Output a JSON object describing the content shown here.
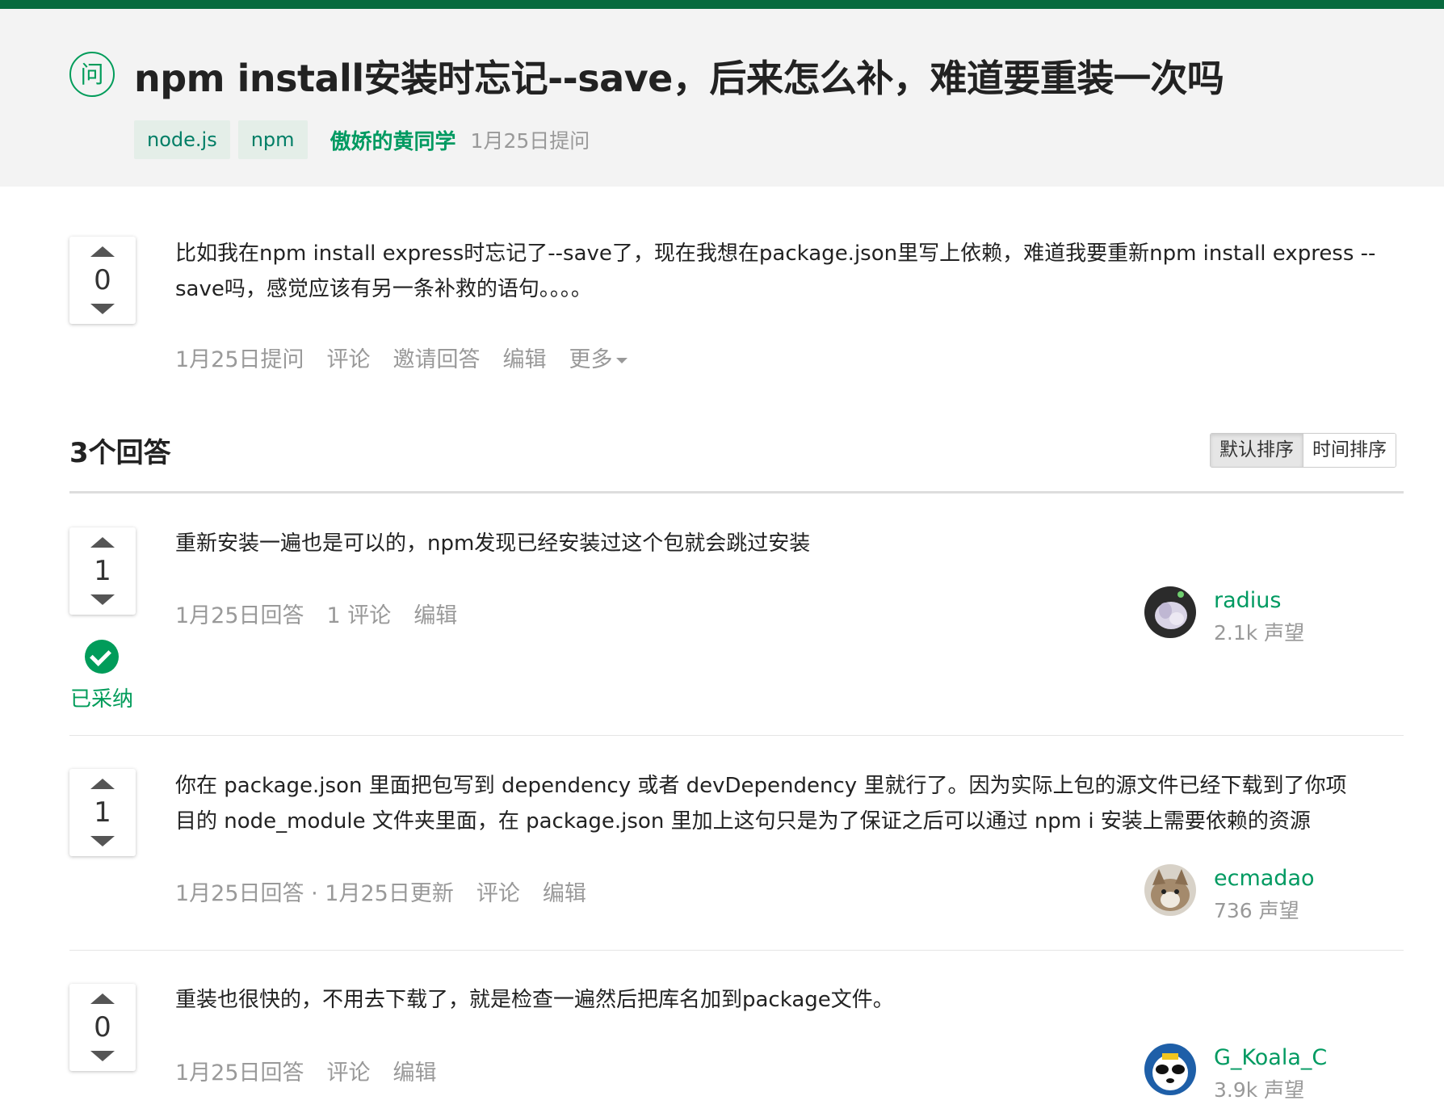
{
  "header": {
    "question_badge": "问",
    "title": "npm install安装时忘记--save，后来怎么补，难道要重装一次吗",
    "tags": [
      "node.js",
      "npm"
    ],
    "author": "傲娇的黄同学",
    "asked_time": "1月25日提问"
  },
  "question": {
    "votes": "0",
    "body_line1": "比如我在npm install express时忘记了--save了，现在我想在package.json里写上依赖，难道我要重新npm install express --",
    "body_line2": "save吗，感觉应该有另一条补救的语句。。。。",
    "actions": {
      "time": "1月25日提问",
      "comment": "评论",
      "invite": "邀请回答",
      "edit": "编辑",
      "more": "更多"
    }
  },
  "answers_header": {
    "title": "3个回答",
    "sort_default": "默认排序",
    "sort_time": "时间排序"
  },
  "answers": [
    {
      "votes": "1",
      "body_line1": "重新安装一遍也是可以的，npm发现已经安装过这个包就会跳过安装",
      "time": "1月25日回答",
      "comment": "1 评论",
      "edit": "编辑",
      "accepted_label": "已采纳",
      "user": {
        "name": "radius",
        "reputation": "2.1k 声望"
      }
    },
    {
      "votes": "1",
      "body_line1": "你在 package.json 里面把包写到 dependency 或者 devDependency 里就行了。因为实际上包的源文件已经下载到了你项",
      "body_line2": "目的 node_module 文件夹里面，在 package.json 里加上这句只是为了保证之后可以通过 npm i 安装上需要依赖的资源",
      "time": "1月25日回答 · 1月25日更新",
      "comment": "评论",
      "edit": "编辑",
      "user": {
        "name": "ecmadao",
        "reputation": "736 声望"
      }
    },
    {
      "votes": "0",
      "body_line1": "重装也很快的，不用去下载了，就是检查一遍然后把库名加到package文件。",
      "time": "1月25日回答",
      "comment": "评论",
      "edit": "编辑",
      "user": {
        "name": "G_Koala_C",
        "reputation": "3.9k 声望"
      }
    }
  ],
  "colors": {
    "brand_green": "#009a61",
    "topbar": "#086a3e",
    "header_bg": "#f3f3f3",
    "tag_bg": "#e4eee8",
    "muted_text": "#999999"
  },
  "icons": [
    "question-badge-icon",
    "vote-up-icon",
    "vote-down-icon",
    "accepted-check-icon",
    "caret-down-icon"
  ]
}
